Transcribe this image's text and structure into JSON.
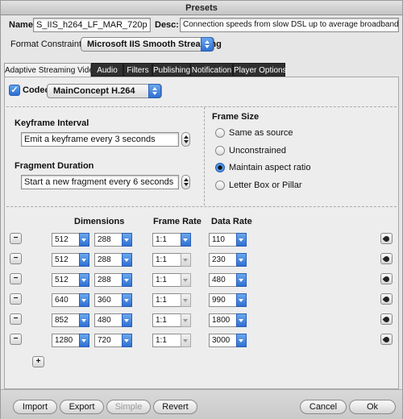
{
  "window": {
    "title": "Presets"
  },
  "header": {
    "name_label": "Name:",
    "name_value": "S_IIS_h264_LF_MAR_720p",
    "desc_label": "Desc:",
    "desc_value": "Connection speeds from slow DSL up to average broadband networks.",
    "format_label": "Format Constraints:",
    "format_value": "Microsoft IIS Smooth Streaming"
  },
  "tabs": [
    {
      "label": "Adaptive Streaming Video",
      "selected": true
    },
    {
      "label": "Audio"
    },
    {
      "label": "Filters"
    },
    {
      "label": "Publishing"
    },
    {
      "label": "Notification"
    },
    {
      "label": "Player Options"
    }
  ],
  "codec": {
    "checked": true,
    "label": "Codec:",
    "value": "MainConcept H.264"
  },
  "keyframe": {
    "label": "Keyframe Interval",
    "value": "Emit a keyframe every 3 seconds"
  },
  "fragment": {
    "label": "Fragment Duration",
    "value": "Start a new fragment every 6 seconds"
  },
  "frame_size": {
    "label": "Frame Size",
    "options": [
      "Same as source",
      "Unconstrained",
      "Maintain aspect ratio",
      "Letter Box or Pillar"
    ],
    "selected": "Maintain aspect ratio"
  },
  "streams": {
    "headers": {
      "dimensions": "Dimensions",
      "frame_rate": "Frame Rate",
      "data_rate": "Data Rate"
    },
    "rows": [
      {
        "width": "512",
        "height": "288",
        "frame_rate": "1:1",
        "data_rate": "110",
        "frame_rate_enabled": true
      },
      {
        "width": "512",
        "height": "288",
        "frame_rate": "1:1",
        "data_rate": "230",
        "frame_rate_enabled": false
      },
      {
        "width": "512",
        "height": "288",
        "frame_rate": "1:1",
        "data_rate": "480",
        "frame_rate_enabled": false
      },
      {
        "width": "640",
        "height": "360",
        "frame_rate": "1:1",
        "data_rate": "990",
        "frame_rate_enabled": false
      },
      {
        "width": "852",
        "height": "480",
        "frame_rate": "1:1",
        "data_rate": "1800",
        "frame_rate_enabled": false
      },
      {
        "width": "1280",
        "height": "720",
        "frame_rate": "1:1",
        "data_rate": "3000",
        "frame_rate_enabled": false
      }
    ],
    "remove_symbol": "−",
    "add_symbol": "+"
  },
  "buttons": {
    "import": "Import",
    "export": "Export",
    "simple": "Simple",
    "revert": "Revert",
    "cancel": "Cancel",
    "ok": "Ok"
  },
  "colors": {
    "accent": "#2f6fd1",
    "tab_dark": "#2f2f2f"
  },
  "icons": {
    "remove": "minus-icon",
    "add": "plus-icon",
    "edit": "edit-icon",
    "check": "checkmark-icon"
  }
}
